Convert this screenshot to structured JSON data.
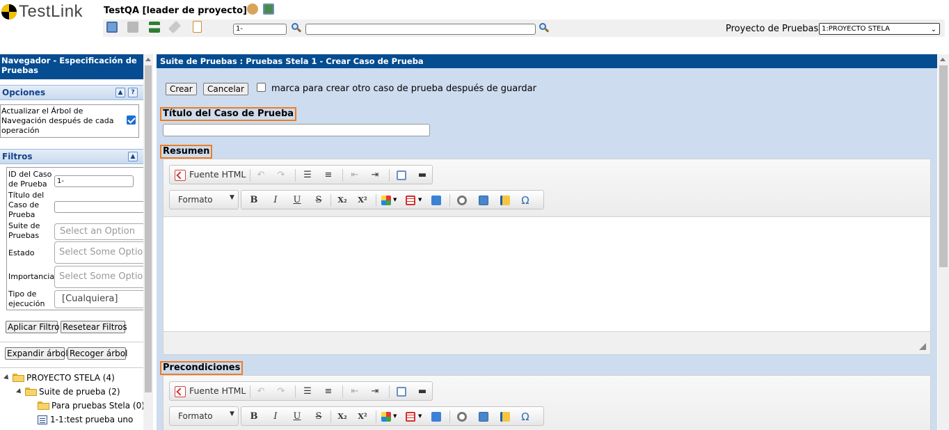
{
  "header": {
    "logo_text": "TestLink",
    "user_info": "TestQA [leader de proyecto]",
    "search_id_value": "1-",
    "search_text_value": "",
    "project_label": "Proyecto de Pruebas",
    "project_selected": "1:PROYECTO STELA",
    "icons": [
      "desktop-icon",
      "cart-icon",
      "hierarchy-icon",
      "tools-icon",
      "document-icon",
      "user-settings-icon",
      "monitor-icon"
    ]
  },
  "nav": {
    "title": "Navegador - Especificación de Pruebas",
    "opciones": {
      "label": "Opciones",
      "help": "?",
      "update_tree_text": "Actualizar el Árbol de Navegación después de cada operación",
      "update_tree_checked": true
    },
    "filtros": {
      "label": "Filtros",
      "id_label": "ID del Caso de Prueba",
      "id_value": "1-",
      "title_label": "Título del Caso de Prueba",
      "title_value": "",
      "suite_label": "Suite de Pruebas",
      "suite_placeholder": "Select an Option",
      "estado_label": "Estado",
      "estado_placeholder": "Select Some Optio",
      "importancia_label": "Importancia",
      "importancia_placeholder": "Select Some Optio",
      "tipo_label": "Tipo de ejecución",
      "tipo_value": "[Cualquiera]",
      "apply_button": "Aplicar Filtro",
      "reset_button": "Resetear Filtros"
    },
    "expand_button": "Expandir árbol",
    "collapse_button": "Recoger árbol",
    "tree": [
      {
        "label": "PROYECTO STELA (4)"
      },
      {
        "label": "Suite de prueba (2)"
      },
      {
        "label": "Para pruebas Stela (0)"
      },
      {
        "label": "1-1:test prueba uno"
      }
    ]
  },
  "main": {
    "title": "Suite de Pruebas : Pruebas Stela 1 - Crear Caso de Prueba",
    "create_button": "Crear",
    "cancel_button": "Cancelar",
    "create_another_label": "marca para crear otro caso de prueba después de guardar",
    "create_another_checked": false,
    "tc_title_label": "Título del Caso de Prueba",
    "tc_title_value": "",
    "summary_label": "Resumen",
    "preconditions_label": "Precondiciones",
    "editor": {
      "source_label": "Fuente HTML",
      "format_label": "Formato",
      "bold": "B",
      "italic": "I",
      "underline": "U",
      "strike": "S",
      "subscript": "X₂",
      "superscript": "X²",
      "special_char": "Ω"
    }
  },
  "colors": {
    "header_blue": "#054c91",
    "body_blue": "#cddcee",
    "highlight_orange": "#f07c1e"
  }
}
